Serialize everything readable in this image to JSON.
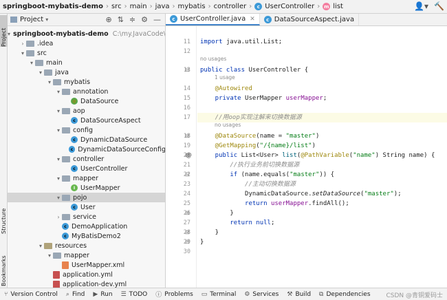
{
  "breadcrumb": {
    "project": "springboot-mybatis-demo",
    "parts": [
      "src",
      "main",
      "java",
      "mybatis",
      "controller"
    ],
    "class_name": "UserController",
    "method_name": "list"
  },
  "side_tabs": {
    "project": "Project",
    "structure": "Structure",
    "bookmarks": "Bookmarks"
  },
  "project_panel": {
    "title": "Project",
    "tree": [
      {
        "label": "springboot-mybatis-demo",
        "hint": "C:\\my.JavaCode\\springboot-mybatis-demo",
        "indent": 0,
        "icon": "folder",
        "arrow": "down",
        "bold": true
      },
      {
        "label": ".idea",
        "indent": 1,
        "icon": "folder",
        "arrow": "right"
      },
      {
        "label": "src",
        "indent": 1,
        "icon": "folder",
        "arrow": "down"
      },
      {
        "label": "main",
        "indent": 2,
        "icon": "folder",
        "arrow": "down"
      },
      {
        "label": "java",
        "indent": 3,
        "icon": "folder",
        "arrow": "down"
      },
      {
        "label": "mybatis",
        "indent": 4,
        "icon": "folder",
        "arrow": "down"
      },
      {
        "label": "annotation",
        "indent": 5,
        "icon": "folder",
        "arrow": "down"
      },
      {
        "label": "DataSource",
        "indent": 6,
        "icon": "annotation"
      },
      {
        "label": "aop",
        "indent": 5,
        "icon": "folder",
        "arrow": "down"
      },
      {
        "label": "DataSourceAspect",
        "indent": 6,
        "icon": "class"
      },
      {
        "label": "config",
        "indent": 5,
        "icon": "folder",
        "arrow": "down"
      },
      {
        "label": "DynamicDataSource",
        "indent": 6,
        "icon": "class"
      },
      {
        "label": "DynamicDataSourceConfig",
        "indent": 6,
        "icon": "class"
      },
      {
        "label": "controller",
        "indent": 5,
        "icon": "folder",
        "arrow": "down"
      },
      {
        "label": "UserController",
        "indent": 6,
        "icon": "class"
      },
      {
        "label": "mapper",
        "indent": 5,
        "icon": "folder",
        "arrow": "down"
      },
      {
        "label": "UserMapper",
        "indent": 6,
        "icon": "interface"
      },
      {
        "label": "pojo",
        "indent": 5,
        "icon": "folder",
        "arrow": "down",
        "selected": true
      },
      {
        "label": "User",
        "indent": 6,
        "icon": "class"
      },
      {
        "label": "service",
        "indent": 5,
        "icon": "folder",
        "arrow": "right"
      },
      {
        "label": "DemoApplication",
        "indent": 5,
        "icon": "class"
      },
      {
        "label": "MyBatisDemo2",
        "indent": 5,
        "icon": "class"
      },
      {
        "label": "resources",
        "indent": 3,
        "icon": "resfolder",
        "arrow": "down"
      },
      {
        "label": "mapper",
        "indent": 4,
        "icon": "folder",
        "arrow": "down"
      },
      {
        "label": "UserMapper.xml",
        "indent": 5,
        "icon": "xml"
      },
      {
        "label": "application.yml",
        "indent": 4,
        "icon": "yml"
      },
      {
        "label": "application-dev.yml",
        "indent": 4,
        "icon": "yml"
      }
    ]
  },
  "editor": {
    "tabs": [
      {
        "label": "UserController.java",
        "active": true
      },
      {
        "label": "DataSourceAspect.java",
        "active": false
      }
    ],
    "lines": [
      {
        "num": "11",
        "parts": [
          {
            "t": "import ",
            "c": "kw"
          },
          {
            "t": "java.util.List;",
            "c": ""
          }
        ]
      },
      {
        "num": "12",
        "parts": []
      },
      {
        "hint": "no usages"
      },
      {
        "num": "13",
        "parts": [
          {
            "t": "public class ",
            "c": "kw"
          },
          {
            "t": "UserController",
            "c": ""
          },
          {
            "t": " {",
            "c": ""
          }
        ]
      },
      {
        "hint": "1 usage",
        "indent": 1
      },
      {
        "num": "14",
        "parts": [
          {
            "t": "    @Autowired",
            "c": "ann"
          }
        ]
      },
      {
        "num": "15",
        "parts": [
          {
            "t": "    private ",
            "c": "kw"
          },
          {
            "t": "UserMapper ",
            "c": ""
          },
          {
            "t": "userMapper",
            "c": "fld"
          },
          {
            "t": ";",
            "c": ""
          }
        ]
      },
      {
        "num": "16",
        "parts": []
      },
      {
        "num": "17",
        "parts": [
          {
            "t": "    //用oop实现注解来切换数据源",
            "c": "cmt"
          }
        ],
        "highlight": true
      },
      {
        "hint": "no usages",
        "indent": 1
      },
      {
        "num": "18",
        "parts": [
          {
            "t": "    @DataSource",
            "c": "ann"
          },
          {
            "t": "(name = ",
            "c": ""
          },
          {
            "t": "\"master\"",
            "c": "str"
          },
          {
            "t": ")",
            "c": ""
          }
        ]
      },
      {
        "num": "19",
        "parts": [
          {
            "t": "    @GetMapping",
            "c": "ann"
          },
          {
            "t": "(",
            "c": ""
          },
          {
            "t": "\"/{name}/list\"",
            "c": "str"
          },
          {
            "t": ")",
            "c": ""
          }
        ]
      },
      {
        "num": "20",
        "parts": [
          {
            "t": "    public ",
            "c": "kw"
          },
          {
            "t": "List<User> ",
            "c": ""
          },
          {
            "t": "list",
            "c": "mth"
          },
          {
            "t": "(",
            "c": ""
          },
          {
            "t": "@PathVariable",
            "c": "ann"
          },
          {
            "t": "(",
            "c": ""
          },
          {
            "t": "\"name\"",
            "c": "str"
          },
          {
            "t": ") String name) {",
            "c": ""
          }
        ],
        "at": true
      },
      {
        "num": "21",
        "parts": [
          {
            "t": "        //执行业务前切换数据源",
            "c": "cmt"
          }
        ]
      },
      {
        "num": "22",
        "parts": [
          {
            "t": "        if ",
            "c": "kw"
          },
          {
            "t": "(name.equals(",
            "c": ""
          },
          {
            "t": "\"master\"",
            "c": "str"
          },
          {
            "t": ")) {",
            "c": ""
          }
        ]
      },
      {
        "num": "23",
        "parts": [
          {
            "t": "            //主动切换数据源",
            "c": "cmt"
          }
        ]
      },
      {
        "num": "24",
        "parts": [
          {
            "t": "            DynamicDataSource.",
            "c": ""
          },
          {
            "t": "setDataSource",
            "c": "static"
          },
          {
            "t": "(",
            "c": ""
          },
          {
            "t": "\"master\"",
            "c": "str"
          },
          {
            "t": ");",
            "c": ""
          }
        ]
      },
      {
        "num": "25",
        "parts": [
          {
            "t": "            return ",
            "c": "kw"
          },
          {
            "t": "userMapper",
            "c": "fld"
          },
          {
            "t": ".findAll();",
            "c": ""
          }
        ]
      },
      {
        "num": "26",
        "parts": [
          {
            "t": "        }",
            "c": ""
          }
        ]
      },
      {
        "num": "27",
        "parts": [
          {
            "t": "        return null",
            "c": "kw"
          },
          {
            "t": ";",
            "c": ""
          }
        ]
      },
      {
        "num": "28",
        "parts": [
          {
            "t": "    }",
            "c": ""
          }
        ]
      },
      {
        "num": "29",
        "parts": [
          {
            "t": "}",
            "c": ""
          }
        ]
      },
      {
        "num": "30",
        "parts": []
      }
    ]
  },
  "bottom_tools": [
    {
      "label": "Version Control",
      "icon": "branch-icon"
    },
    {
      "label": "Find",
      "icon": "search-icon"
    },
    {
      "label": "Run",
      "icon": "play-icon"
    },
    {
      "label": "TODO",
      "icon": "list-icon"
    },
    {
      "label": "Problems",
      "icon": "warning-icon"
    },
    {
      "label": "Terminal",
      "icon": "terminal-icon"
    },
    {
      "label": "Services",
      "icon": "services-icon"
    },
    {
      "label": "Build",
      "icon": "hammer-icon"
    },
    {
      "label": "Dependencies",
      "icon": "dependencies-icon"
    }
  ],
  "watermark": "CSDN @青铜爱码士",
  "colors": {
    "accent": "#4083c9",
    "selection": "#d5d5d5",
    "keyword": "#0033b3",
    "annotation": "#9e880d",
    "string": "#067d17",
    "comment": "#8c8c8c"
  }
}
